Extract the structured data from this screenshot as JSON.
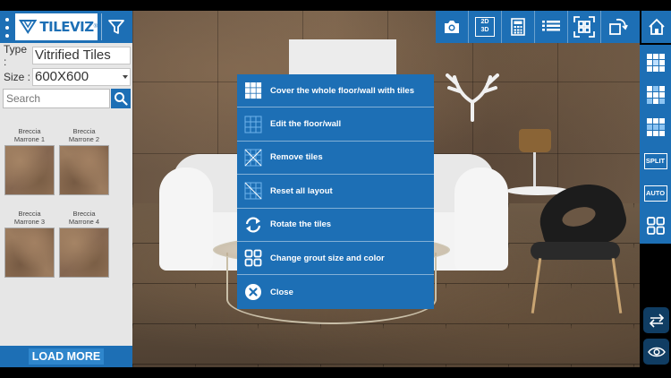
{
  "brand": {
    "logo_text": "TILEVIZ",
    "reg_mark": "®"
  },
  "filters": {
    "type_label": "Type :",
    "type_value": "Vitrified Tiles",
    "size_label": "Size :",
    "size_value": "600X600"
  },
  "search": {
    "placeholder": "Search"
  },
  "tiles": [
    {
      "name_line1": "Breccia",
      "name_line2": "Marrone 1"
    },
    {
      "name_line1": "Breccia",
      "name_line2": "Marrone 2"
    },
    {
      "name_line1": "Breccia",
      "name_line2": "Marrone 3"
    },
    {
      "name_line1": "Breccia",
      "name_line2": "Marrone 4"
    }
  ],
  "load_more_label": "LOAD MORE",
  "toolbar": {
    "mode_2d": "2D",
    "mode_3d": "3D",
    "icons": [
      "camera-icon",
      "2d-3d-toggle",
      "calculator-icon",
      "list-icon",
      "fit-screen-icon",
      "rotate-view-icon"
    ]
  },
  "right_toolbar": {
    "split_label": "SPLIT",
    "auto_label": "AUTO",
    "icons": [
      "home-icon",
      "layout-1-icon",
      "layout-2-icon",
      "layout-3-icon",
      "split-button",
      "auto-button",
      "grid-icon",
      "swap-icon",
      "eye-icon"
    ]
  },
  "menu": {
    "items": [
      {
        "label": "Cover the whole floor/wall with tiles",
        "icon": "cover-tiles-icon"
      },
      {
        "label": "Edit the floor/wall",
        "icon": "edit-grid-icon"
      },
      {
        "label": "Remove tiles",
        "icon": "remove-tiles-icon"
      },
      {
        "label": "Reset all layout",
        "icon": "reset-layout-icon"
      },
      {
        "label": "Rotate the tiles",
        "icon": "rotate-icon"
      },
      {
        "label": "Change grout size and color",
        "icon": "grout-icon"
      },
      {
        "label": "Close",
        "icon": "close-icon"
      }
    ]
  },
  "colors": {
    "primary": "#1d6fb5",
    "panel_bg": "#e6e6e6",
    "menu_text": "#ffffff"
  }
}
